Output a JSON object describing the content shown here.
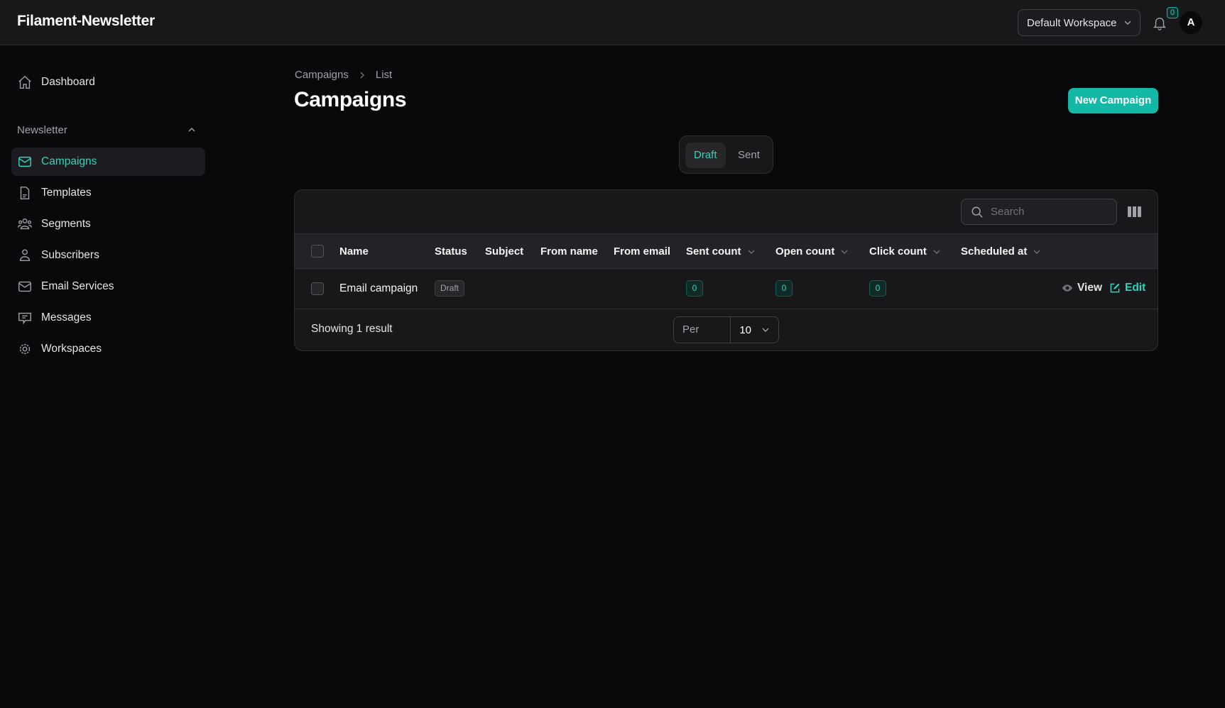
{
  "app": {
    "title": "Filament-Newsletter",
    "workspace": "Default Workspace",
    "notifications": "0",
    "avatar_initial": "A"
  },
  "sidebar": {
    "dashboard": "Dashboard",
    "group": "Newsletter",
    "items": [
      {
        "label": "Campaigns",
        "icon": "envelope-icon",
        "active": true
      },
      {
        "label": "Templates",
        "icon": "document-icon"
      },
      {
        "label": "Segments",
        "icon": "user-group-icon"
      },
      {
        "label": "Subscribers",
        "icon": "user-icon"
      },
      {
        "label": "Email Services",
        "icon": "envelope-icon"
      },
      {
        "label": "Messages",
        "icon": "chat-icon"
      },
      {
        "label": "Workspaces",
        "icon": "cog-icon"
      }
    ]
  },
  "breadcrumb": [
    "Campaigns",
    "List"
  ],
  "page": {
    "title": "Campaigns",
    "new_button": "New Campaign"
  },
  "tabs": [
    {
      "label": "Draft",
      "active": true
    },
    {
      "label": "Sent"
    }
  ],
  "table": {
    "search_placeholder": "Search",
    "columns": [
      "Name",
      "Status",
      "Subject",
      "From name",
      "From email",
      "Sent count",
      "Open count",
      "Click count",
      "Scheduled at"
    ],
    "rows": [
      {
        "name": "Email campaign",
        "status": "Draft",
        "subject": "",
        "from_name": "",
        "from_email": "",
        "sent_count": "0",
        "open_count": "0",
        "click_count": "0",
        "scheduled_at": "",
        "actions": [
          "View",
          "Edit"
        ]
      }
    ],
    "footer": {
      "showing": "Showing 1 result",
      "per_page_label": "Per page",
      "per_page": "10"
    }
  },
  "colors": {
    "accent": "#14b8a6",
    "background": "#09090b",
    "surface": "#18181b"
  }
}
